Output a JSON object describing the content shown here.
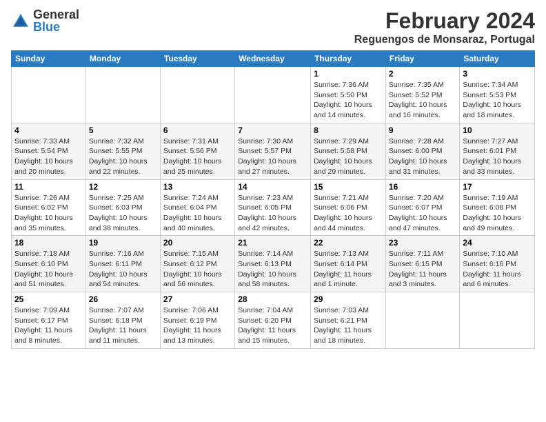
{
  "logo": {
    "line1": "General",
    "line2": "Blue"
  },
  "title": "February 2024",
  "subtitle": "Reguengos de Monsaraz, Portugal",
  "days_of_week": [
    "Sunday",
    "Monday",
    "Tuesday",
    "Wednesday",
    "Thursday",
    "Friday",
    "Saturday"
  ],
  "weeks": [
    [
      {
        "day": "",
        "info": ""
      },
      {
        "day": "",
        "info": ""
      },
      {
        "day": "",
        "info": ""
      },
      {
        "day": "",
        "info": ""
      },
      {
        "day": "1",
        "info": "Sunrise: 7:36 AM\nSunset: 5:50 PM\nDaylight: 10 hours and 14 minutes."
      },
      {
        "day": "2",
        "info": "Sunrise: 7:35 AM\nSunset: 5:52 PM\nDaylight: 10 hours and 16 minutes."
      },
      {
        "day": "3",
        "info": "Sunrise: 7:34 AM\nSunset: 5:53 PM\nDaylight: 10 hours and 18 minutes."
      }
    ],
    [
      {
        "day": "4",
        "info": "Sunrise: 7:33 AM\nSunset: 5:54 PM\nDaylight: 10 hours and 20 minutes."
      },
      {
        "day": "5",
        "info": "Sunrise: 7:32 AM\nSunset: 5:55 PM\nDaylight: 10 hours and 22 minutes."
      },
      {
        "day": "6",
        "info": "Sunrise: 7:31 AM\nSunset: 5:56 PM\nDaylight: 10 hours and 25 minutes."
      },
      {
        "day": "7",
        "info": "Sunrise: 7:30 AM\nSunset: 5:57 PM\nDaylight: 10 hours and 27 minutes."
      },
      {
        "day": "8",
        "info": "Sunrise: 7:29 AM\nSunset: 5:58 PM\nDaylight: 10 hours and 29 minutes."
      },
      {
        "day": "9",
        "info": "Sunrise: 7:28 AM\nSunset: 6:00 PM\nDaylight: 10 hours and 31 minutes."
      },
      {
        "day": "10",
        "info": "Sunrise: 7:27 AM\nSunset: 6:01 PM\nDaylight: 10 hours and 33 minutes."
      }
    ],
    [
      {
        "day": "11",
        "info": "Sunrise: 7:26 AM\nSunset: 6:02 PM\nDaylight: 10 hours and 35 minutes."
      },
      {
        "day": "12",
        "info": "Sunrise: 7:25 AM\nSunset: 6:03 PM\nDaylight: 10 hours and 38 minutes."
      },
      {
        "day": "13",
        "info": "Sunrise: 7:24 AM\nSunset: 6:04 PM\nDaylight: 10 hours and 40 minutes."
      },
      {
        "day": "14",
        "info": "Sunrise: 7:23 AM\nSunset: 6:05 PM\nDaylight: 10 hours and 42 minutes."
      },
      {
        "day": "15",
        "info": "Sunrise: 7:21 AM\nSunset: 6:06 PM\nDaylight: 10 hours and 44 minutes."
      },
      {
        "day": "16",
        "info": "Sunrise: 7:20 AM\nSunset: 6:07 PM\nDaylight: 10 hours and 47 minutes."
      },
      {
        "day": "17",
        "info": "Sunrise: 7:19 AM\nSunset: 6:08 PM\nDaylight: 10 hours and 49 minutes."
      }
    ],
    [
      {
        "day": "18",
        "info": "Sunrise: 7:18 AM\nSunset: 6:10 PM\nDaylight: 10 hours and 51 minutes."
      },
      {
        "day": "19",
        "info": "Sunrise: 7:16 AM\nSunset: 6:11 PM\nDaylight: 10 hours and 54 minutes."
      },
      {
        "day": "20",
        "info": "Sunrise: 7:15 AM\nSunset: 6:12 PM\nDaylight: 10 hours and 56 minutes."
      },
      {
        "day": "21",
        "info": "Sunrise: 7:14 AM\nSunset: 6:13 PM\nDaylight: 10 hours and 58 minutes."
      },
      {
        "day": "22",
        "info": "Sunrise: 7:13 AM\nSunset: 6:14 PM\nDaylight: 11 hours and 1 minute."
      },
      {
        "day": "23",
        "info": "Sunrise: 7:11 AM\nSunset: 6:15 PM\nDaylight: 11 hours and 3 minutes."
      },
      {
        "day": "24",
        "info": "Sunrise: 7:10 AM\nSunset: 6:16 PM\nDaylight: 11 hours and 6 minutes."
      }
    ],
    [
      {
        "day": "25",
        "info": "Sunrise: 7:09 AM\nSunset: 6:17 PM\nDaylight: 11 hours and 8 minutes."
      },
      {
        "day": "26",
        "info": "Sunrise: 7:07 AM\nSunset: 6:18 PM\nDaylight: 11 hours and 11 minutes."
      },
      {
        "day": "27",
        "info": "Sunrise: 7:06 AM\nSunset: 6:19 PM\nDaylight: 11 hours and 13 minutes."
      },
      {
        "day": "28",
        "info": "Sunrise: 7:04 AM\nSunset: 6:20 PM\nDaylight: 11 hours and 15 minutes."
      },
      {
        "day": "29",
        "info": "Sunrise: 7:03 AM\nSunset: 6:21 PM\nDaylight: 11 hours and 18 minutes."
      },
      {
        "day": "",
        "info": ""
      },
      {
        "day": "",
        "info": ""
      }
    ]
  ]
}
